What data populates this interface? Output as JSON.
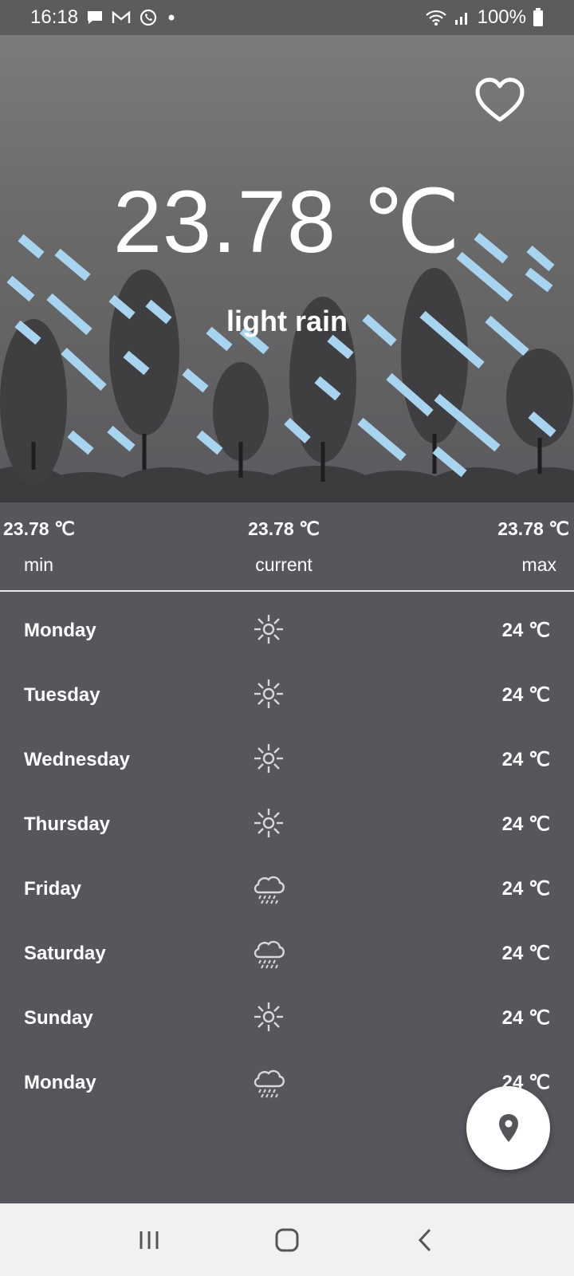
{
  "status_bar": {
    "time": "16:18",
    "battery": "100%",
    "left_icons": [
      "message-icon",
      "gmail-icon",
      "whatsapp-icon",
      "dot-icon"
    ],
    "right_icons": [
      "wifi-icon",
      "signal-icon",
      "battery-icon"
    ]
  },
  "hero": {
    "temperature": "23.78 ℃",
    "condition": "light rain",
    "favorite_icon": "heart-outline-icon"
  },
  "summary": {
    "min_value": "23.78 ℃",
    "min_label": "min",
    "current_value": "23.78 ℃",
    "current_label": "current",
    "max_value": "23.78 ℃",
    "max_label": "max"
  },
  "forecast": [
    {
      "day": "Monday",
      "icon": "sun-icon",
      "temp": "24 ℃"
    },
    {
      "day": "Tuesday",
      "icon": "sun-icon",
      "temp": "24 ℃"
    },
    {
      "day": "Wednesday",
      "icon": "sun-icon",
      "temp": "24 ℃"
    },
    {
      "day": "Thursday",
      "icon": "sun-icon",
      "temp": "24 ℃"
    },
    {
      "day": "Friday",
      "icon": "cloud-rain-icon",
      "temp": "24 ℃"
    },
    {
      "day": "Saturday",
      "icon": "cloud-rain-icon",
      "temp": "24 ℃"
    },
    {
      "day": "Sunday",
      "icon": "sun-icon",
      "temp": "24 ℃"
    },
    {
      "day": "Monday",
      "icon": "cloud-rain-icon",
      "temp": "24 ℃"
    }
  ],
  "fab": {
    "icon": "location-pin-icon"
  },
  "nav": {
    "icons": [
      "recent-apps-icon",
      "home-icon",
      "back-icon"
    ]
  },
  "colors": {
    "background": "#57565c",
    "hero_top": "#7b7b7b",
    "tree": "#3f3f42",
    "rain": "#a9d4f0",
    "nav_bar": "#f1f1f1",
    "fab": "#ffffff"
  }
}
